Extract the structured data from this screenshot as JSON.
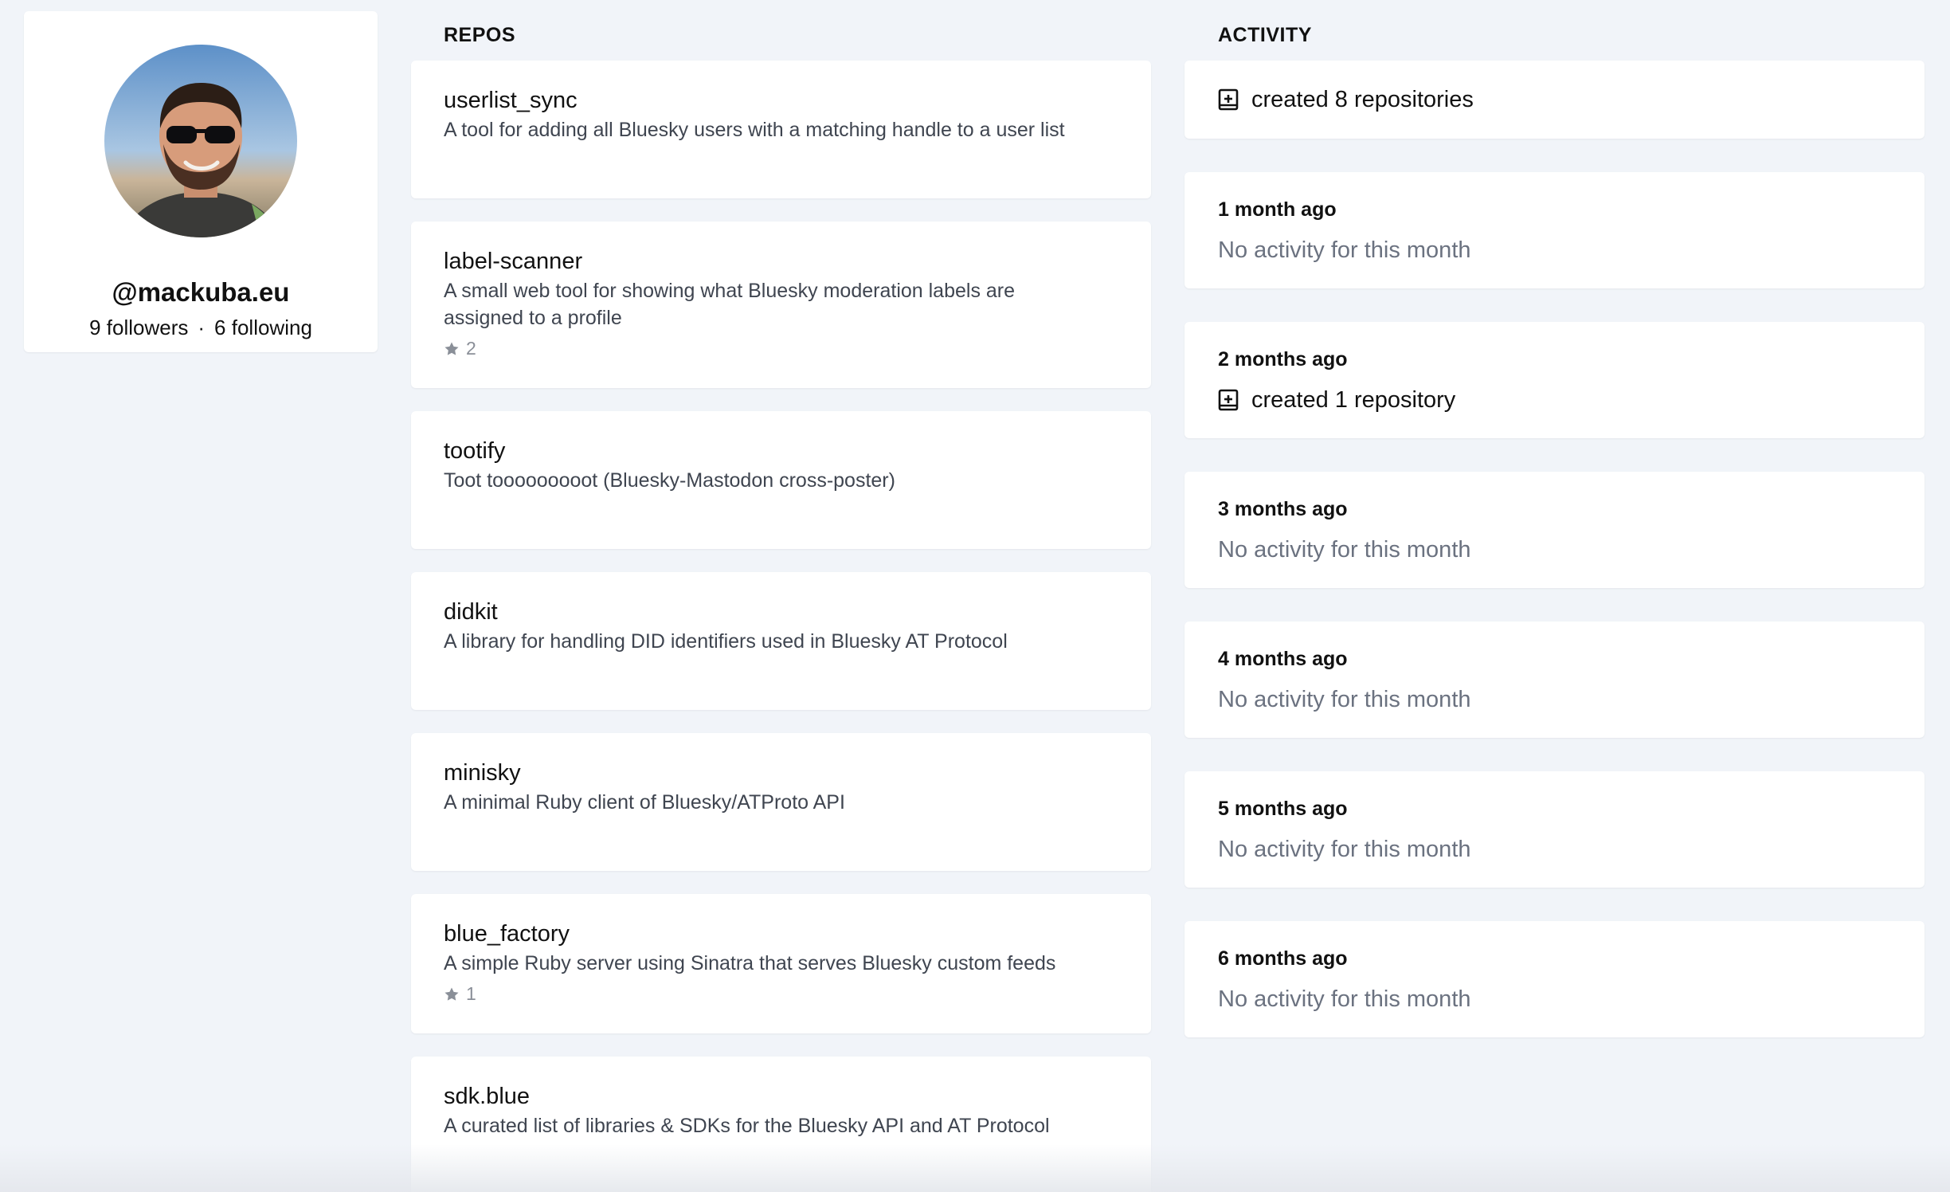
{
  "profile": {
    "handle": "@mackuba.eu",
    "followers": "9 followers",
    "separator": "·",
    "following": "6 following"
  },
  "repos": {
    "title": "REPOS",
    "items": [
      {
        "name": "userlist_sync",
        "description": "A tool for adding all Bluesky users with a matching handle to a user list",
        "stars": null
      },
      {
        "name": "label-scanner",
        "description": "A small web tool for showing what Bluesky moderation labels are assigned to a profile",
        "stars": "2"
      },
      {
        "name": "tootify",
        "description": "Toot tooooooooot (Bluesky-Mastodon cross-poster)",
        "stars": null
      },
      {
        "name": "didkit",
        "description": "A library for handling DID identifiers used in Bluesky AT Protocol",
        "stars": null
      },
      {
        "name": "minisky",
        "description": "A minimal Ruby client of Bluesky/ATProto API",
        "stars": null
      },
      {
        "name": "blue_factory",
        "description": "A simple Ruby server using Sinatra that serves Bluesky custom feeds",
        "stars": "1"
      },
      {
        "name": "sdk.blue",
        "description": "A curated list of libraries & SDKs for the Bluesky API and AT Protocol",
        "stars": null
      }
    ]
  },
  "activity": {
    "title": "ACTIVITY",
    "items": [
      {
        "when": "",
        "text": "created 8 repositories",
        "type": "created"
      },
      {
        "when": "1 month ago",
        "text": "No activity for this month",
        "type": "empty"
      },
      {
        "when": "2 months ago",
        "text": "created 1 repository",
        "type": "created"
      },
      {
        "when": "3 months ago",
        "text": "No activity for this month",
        "type": "empty"
      },
      {
        "when": "4 months ago",
        "text": "No activity for this month",
        "type": "empty"
      },
      {
        "when": "5 months ago",
        "text": "No activity for this month",
        "type": "empty"
      },
      {
        "when": "6 months ago",
        "text": "No activity for this month",
        "type": "empty"
      }
    ]
  },
  "icons": {
    "star": "star-icon",
    "repo": "repo-add-icon",
    "avatar": "avatar"
  },
  "colors": {
    "background": "#f1f4f9",
    "card": "#ffffff",
    "muted": "#6b7280",
    "star": "#8a8f98"
  }
}
